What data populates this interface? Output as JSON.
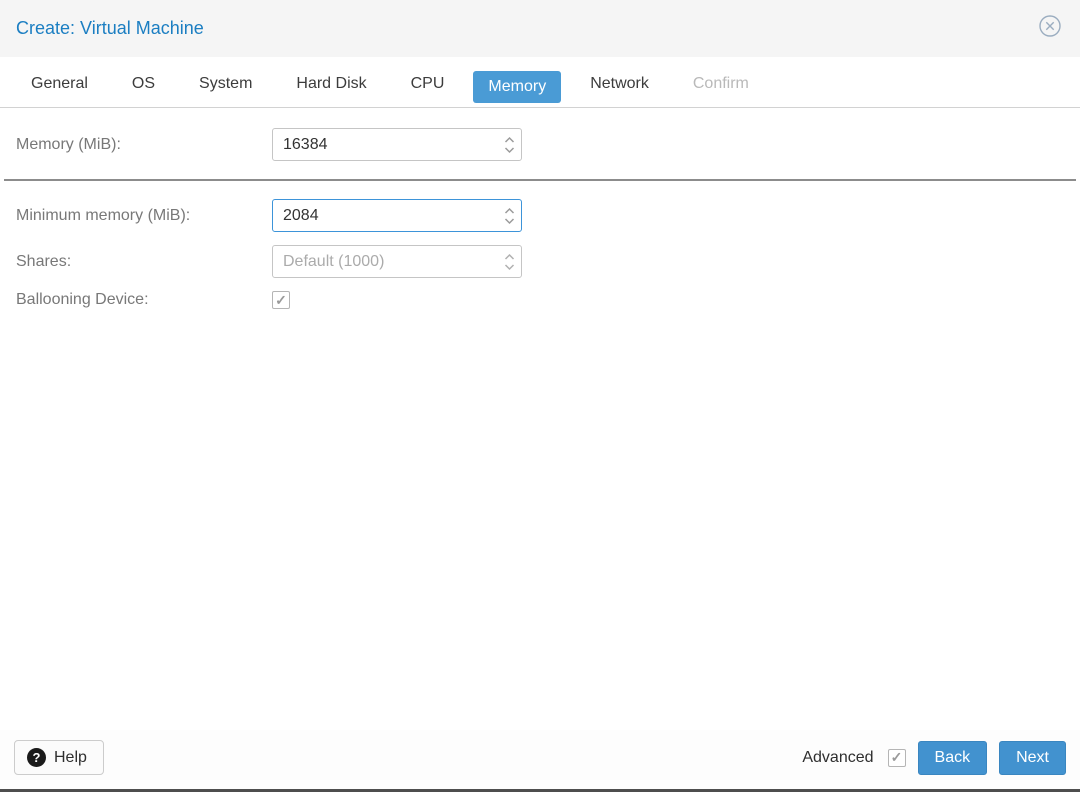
{
  "window": {
    "title": "Create: Virtual Machine"
  },
  "tabs": [
    {
      "label": "General",
      "state": "normal"
    },
    {
      "label": "OS",
      "state": "normal"
    },
    {
      "label": "System",
      "state": "normal"
    },
    {
      "label": "Hard Disk",
      "state": "normal"
    },
    {
      "label": "CPU",
      "state": "normal"
    },
    {
      "label": "Memory",
      "state": "active"
    },
    {
      "label": "Network",
      "state": "normal"
    },
    {
      "label": "Confirm",
      "state": "disabled"
    }
  ],
  "form": {
    "memory": {
      "label": "Memory (MiB):",
      "value": "16384"
    },
    "min_memory": {
      "label": "Minimum memory (MiB):",
      "value": "2084",
      "focused": true
    },
    "shares": {
      "label": "Shares:",
      "value": "Default (1000)",
      "disabled": true
    },
    "ballooning": {
      "label": "Ballooning Device:",
      "checked": true
    }
  },
  "footer": {
    "help_label": "Help",
    "advanced_label": "Advanced",
    "advanced_checked": true,
    "back_label": "Back",
    "next_label": "Next"
  },
  "icons": {
    "close": "✕",
    "help": "?",
    "check": "✓"
  },
  "colors": {
    "title_blue": "#1b7ec2",
    "active_tab_blue": "#4a9bd5",
    "button_blue": "#4292cf",
    "focus_border_blue": "#3d94d9",
    "separator_gray": "#8c8c8c"
  }
}
